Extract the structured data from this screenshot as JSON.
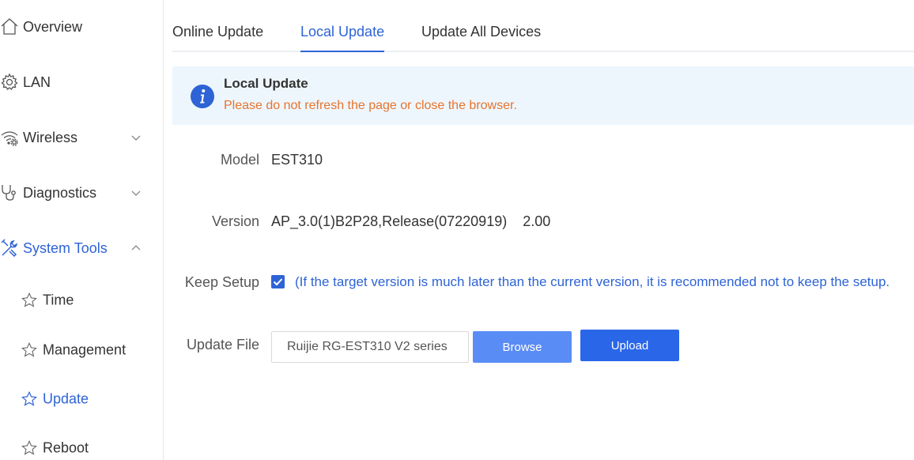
{
  "sidebar": {
    "items": [
      {
        "label": "Overview",
        "icon": "home-icon"
      },
      {
        "label": "LAN",
        "icon": "gear-icon"
      },
      {
        "label": "Wireless",
        "icon": "wifi-gear-icon",
        "expandable": true
      },
      {
        "label": "Diagnostics",
        "icon": "stethoscope-icon",
        "expandable": true
      },
      {
        "label": "System Tools",
        "icon": "tools-icon",
        "expanded": true,
        "active": true
      }
    ],
    "sub_items": [
      {
        "label": "Time",
        "icon": "star-icon"
      },
      {
        "label": "Management",
        "icon": "star-icon"
      },
      {
        "label": "Update",
        "icon": "star-icon",
        "active": true
      },
      {
        "label": "Reboot",
        "icon": "star-icon"
      }
    ]
  },
  "tabs": [
    {
      "label": "Online Update"
    },
    {
      "label": "Local Update",
      "active": true
    },
    {
      "label": "Update All Devices"
    }
  ],
  "alert": {
    "title": "Local Update",
    "message": "Please do not refresh the page or close the browser."
  },
  "form": {
    "model_label": "Model",
    "model_value": "EST310",
    "version_label": "Version",
    "version_value": "AP_3.0(1)B2P28,Release(07220919)    2.00",
    "keep_setup_label": "Keep Setup",
    "keep_setup_checked": true,
    "keep_setup_hint": "(If the target version is much later than the current version, it is recommended not to keep the setup.",
    "update_file_label": "Update File",
    "update_file_value": "Ruijie RG-EST310 V2 series",
    "browse_label": "Browse",
    "upload_label": "Upload"
  },
  "colors": {
    "accent": "#2e63d6",
    "warning": "#e6742e",
    "alert_bg": "#eef6fd",
    "browse_bg": "#5a8cf5",
    "upload_bg": "#2a66e8"
  }
}
